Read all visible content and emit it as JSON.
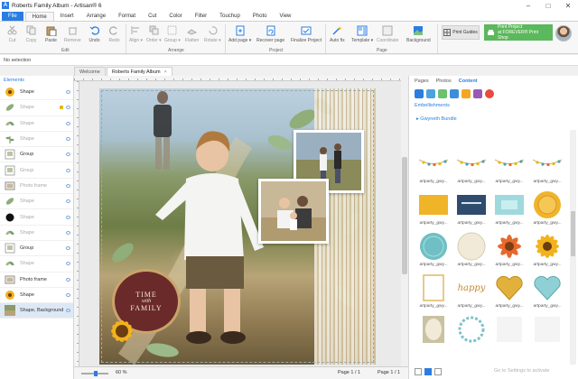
{
  "window": {
    "title": "Roberts Family Album - Artisan® 6",
    "minimize": "–",
    "maximize": "□",
    "close": "✕"
  },
  "ribbon_tabs": [
    "File",
    "Home",
    "Insert",
    "Arrange",
    "Format",
    "Cut",
    "Color",
    "Filter",
    "Touchup",
    "Photo",
    "View"
  ],
  "ribbon": {
    "buttons": [
      {
        "label": "Cut",
        "icon": "scissors-icon",
        "enabled": false
      },
      {
        "label": "Copy",
        "icon": "copy-icon",
        "enabled": false
      },
      {
        "label": "Paste",
        "icon": "paste-icon",
        "enabled": true
      },
      {
        "label": "Remove",
        "icon": "remove-icon",
        "enabled": false
      },
      {
        "label": "Undo",
        "icon": "undo-icon",
        "enabled": true
      },
      {
        "label": "Redo",
        "icon": "redo-icon",
        "enabled": false
      },
      {
        "label": "Align ▾",
        "icon": "align-icon",
        "enabled": false
      },
      {
        "label": "Order ▾",
        "icon": "order-icon",
        "enabled": false
      },
      {
        "label": "Group ▾",
        "icon": "group-icon",
        "enabled": false
      },
      {
        "label": "Flatten",
        "icon": "flatten-icon",
        "enabled": false
      },
      {
        "label": "Rotate ▾",
        "icon": "rotate-icon",
        "enabled": false
      },
      {
        "label": "Add page ▾",
        "icon": "add-page-icon",
        "enabled": true
      },
      {
        "label": "Recover page",
        "icon": "recover-page-icon",
        "enabled": true
      },
      {
        "label": "Finalize Project",
        "icon": "finalize-icon",
        "enabled": true
      },
      {
        "label": "Auto fix",
        "icon": "auto-fix-icon",
        "enabled": true
      },
      {
        "label": "Template ▾",
        "icon": "template-icon",
        "enabled": true
      },
      {
        "label": "Coordinate",
        "icon": "coordinate-icon",
        "enabled": false
      },
      {
        "label": "Background",
        "icon": "background-icon",
        "enabled": true
      }
    ],
    "groups": [
      "Edit",
      "Arrange",
      "Project",
      "Page"
    ],
    "print_guides": "Print Guides",
    "print_project_line1": "Print Project",
    "print_project_line2": "at FOREVER® Print Shop"
  },
  "status": {
    "selection": "No selection"
  },
  "doc_tabs": [
    {
      "label": "Welcome",
      "active": false
    },
    {
      "label": "Roberts Family Album",
      "active": true
    }
  ],
  "doc_tab_close": "×",
  "elements_panel": {
    "header": "Elements",
    "items": [
      {
        "label": "Shape",
        "dim": false,
        "locked": false,
        "thumb": "sunflower"
      },
      {
        "label": "Shape",
        "dim": true,
        "locked": true,
        "thumb": "leaf"
      },
      {
        "label": "Shape",
        "dim": true,
        "locked": false,
        "thumb": "leaves"
      },
      {
        "label": "Shape",
        "dim": true,
        "locked": false,
        "thumb": "plant"
      },
      {
        "label": "Group",
        "dim": false,
        "locked": false,
        "thumb": "group"
      },
      {
        "label": "Group",
        "dim": true,
        "locked": false,
        "thumb": "group"
      },
      {
        "label": "Photo frame",
        "dim": true,
        "locked": false,
        "thumb": "frame"
      },
      {
        "label": "Shape",
        "dim": true,
        "locked": false,
        "thumb": "leaf"
      },
      {
        "label": "Shape",
        "dim": true,
        "locked": false,
        "thumb": "blot"
      },
      {
        "label": "Shape",
        "dim": true,
        "locked": false,
        "thumb": "leaves"
      },
      {
        "label": "Group",
        "dim": false,
        "locked": false,
        "thumb": "group"
      },
      {
        "label": "Shape",
        "dim": true,
        "locked": false,
        "thumb": "leaves"
      },
      {
        "label": "Photo frame",
        "dim": false,
        "locked": false,
        "thumb": "frame"
      },
      {
        "label": "Shape",
        "dim": false,
        "locked": false,
        "thumb": "sunflower"
      },
      {
        "label": "Shape, Background",
        "dim": false,
        "locked": false,
        "thumb": "background",
        "selected": true
      }
    ]
  },
  "badge": {
    "line1": "TIME",
    "line2": "with",
    "line3": "FAMILY"
  },
  "bottom_bar": {
    "zoom": "60 %",
    "page_center": "Page 1 / 1",
    "page_right": "Page 1 / 1",
    "zoom_level": 0.6
  },
  "right_panel": {
    "tabs": [
      {
        "label": "Pages",
        "active": false
      },
      {
        "label": "Photos",
        "active": false
      },
      {
        "label": "Content",
        "active": true
      }
    ],
    "section": "Embellishments",
    "folder": "Gwyneth Bundle",
    "items": [
      {
        "name": "artparty_gwy...",
        "kind": "string-lights"
      },
      {
        "name": "artparty_gwy...",
        "kind": "string-lights"
      },
      {
        "name": "artparty_gwy...",
        "kind": "string-lights"
      },
      {
        "name": "artparty_gwy...",
        "kind": "string-lights"
      },
      {
        "name": "artparty_gwy...",
        "kind": "yellow-tag"
      },
      {
        "name": "artparty_gwy...",
        "kind": "navy-tag"
      },
      {
        "name": "artparty_gwy...",
        "kind": "teal-tag"
      },
      {
        "name": "artparty_gwy...",
        "kind": "sun-badge"
      },
      {
        "name": "artparty_gwy...",
        "kind": "teal-circle"
      },
      {
        "name": "artparty_gwy...",
        "kind": "cream-circle"
      },
      {
        "name": "artparty_gwy...",
        "kind": "orange-flower"
      },
      {
        "name": "artparty_gwy...",
        "kind": "sunflower"
      },
      {
        "name": "artparty_gwy...",
        "kind": "gold-frame"
      },
      {
        "name": "artparty_gwy...",
        "kind": "happy-text"
      },
      {
        "name": "artparty_gwy...",
        "kind": "gold-heart"
      },
      {
        "name": "artparty_gwy...",
        "kind": "teal-heart"
      },
      {
        "name": "",
        "kind": "oval-frame"
      },
      {
        "name": "",
        "kind": "flower-frame"
      },
      {
        "name": "",
        "kind": "blank"
      },
      {
        "name": "",
        "kind": "blank"
      }
    ],
    "item_word": "happy",
    "activate_text": "Go to Settings to activate"
  },
  "colors": {
    "accent": "#2a7de1",
    "print_green": "#5cb85c",
    "badge_red": "#6b2a2a"
  }
}
